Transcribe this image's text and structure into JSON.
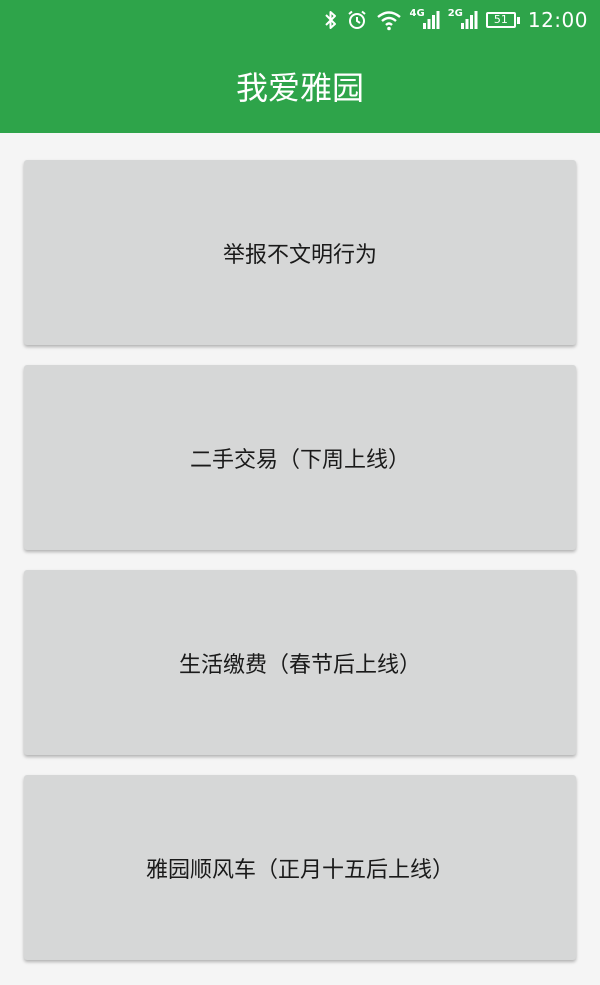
{
  "status_bar": {
    "bluetooth_icon": "bluetooth-icon",
    "alarm_icon": "alarm-icon",
    "wifi_icon": "wifi-icon",
    "network_1": "4G",
    "network_2": "2G",
    "battery_level": "51",
    "time": "12:00"
  },
  "app_bar": {
    "title": "我爱雅园",
    "color": "#2ea44a"
  },
  "menu": {
    "items": [
      {
        "label": "举报不文明行为"
      },
      {
        "label": "二手交易（下周上线）"
      },
      {
        "label": "生活缴费（春节后上线）"
      },
      {
        "label": "雅园顺风车（正月十五后上线）"
      }
    ]
  }
}
